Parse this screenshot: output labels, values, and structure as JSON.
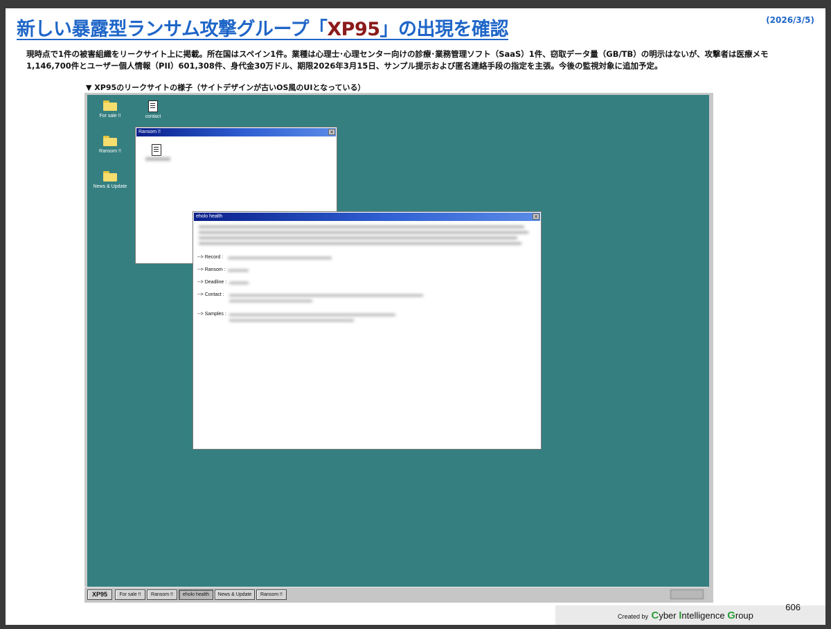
{
  "slide": {
    "title_pre": "新しい暴露型ランサム攻撃グループ「",
    "title_highlight": "XP95",
    "title_post": "」の出現を確認",
    "date": "(2026/3/5)",
    "summary": "現時点で1件の被害組織をリークサイト上に掲載。所在国はスペイン1件。業種は心理士･心理センター向けの診療･業務管理ソフト（SaaS）1件、窃取データ量（GB/TB）の明示はないが、攻撃者は医療メモ1,146,700件とユーザー個人情報（PII）601,308件、身代金30万ドル、期限2026年3月15日、サンプル提示および匿名連絡手段の指定を主張。今後の監視対象に追加予定。",
    "caption": "▼ XP95のリークサイトの様子（サイトデザインが古いOS風のUIとなっている）",
    "page_number": "606"
  },
  "footer": {
    "prefix": "Created by",
    "org_c": "C",
    "org_1": "yber ",
    "org_i": "I",
    "org_2": "ntelligence ",
    "org_g": "G",
    "org_3": "roup"
  },
  "desktop": {
    "background_color": "#357f80",
    "icons": [
      {
        "label": "For sale !!",
        "icon": "folder-icon"
      },
      {
        "label": "contact",
        "icon": "document-icon"
      },
      {
        "label": "Ransom !!",
        "icon": "folder-icon"
      },
      {
        "label": "News & Update",
        "icon": "folder-icon"
      }
    ]
  },
  "windows": {
    "ransom": {
      "title": "Ransom !!",
      "close_glyph": "✕"
    },
    "eholo": {
      "title": "eholo health",
      "close_glyph": "✕",
      "fields": [
        {
          "label": "--> Record :"
        },
        {
          "label": "--> Ransom :"
        },
        {
          "label": "--> Deadline :"
        },
        {
          "label": "--> Contact :"
        },
        {
          "label": "--> Samples :"
        }
      ]
    }
  },
  "taskbar": {
    "start_label": "XP95",
    "buttons": [
      "For sale !!",
      "Ransom !!",
      "eholo health",
      "News & Update",
      "Ransom !!"
    ],
    "active_index": 2
  }
}
